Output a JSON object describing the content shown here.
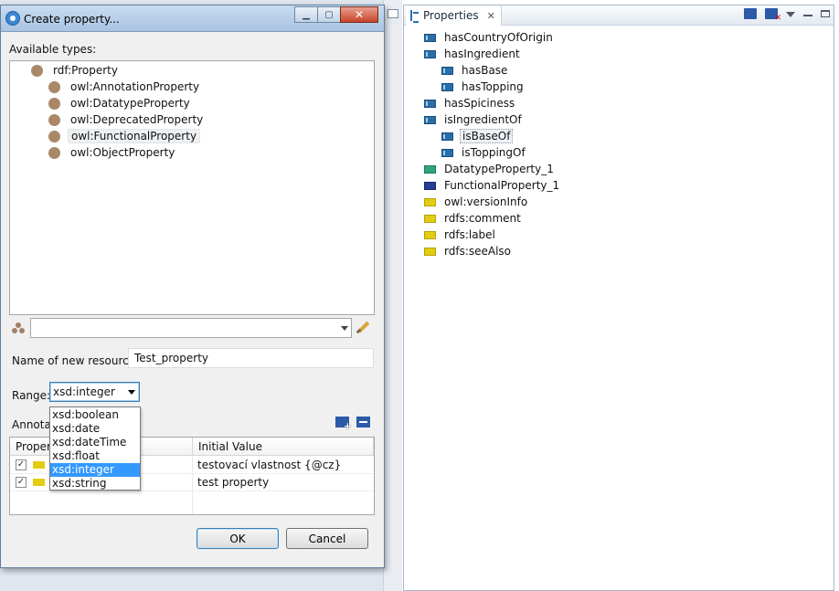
{
  "properties_view": {
    "tab_label": "Properties",
    "items": [
      {
        "label": "hasCountryOfOrigin",
        "kind": "object",
        "indent": 0
      },
      {
        "label": "hasIngredient",
        "kind": "object",
        "indent": 0
      },
      {
        "label": "hasBase",
        "kind": "object",
        "indent": 1
      },
      {
        "label": "hasTopping",
        "kind": "object",
        "indent": 1
      },
      {
        "label": "hasSpiciness",
        "kind": "object",
        "indent": 0
      },
      {
        "label": "isIngredientOf",
        "kind": "object",
        "indent": 0
      },
      {
        "label": "isBaseOf",
        "kind": "object",
        "indent": 1,
        "selected": true
      },
      {
        "label": "isToppingOf",
        "kind": "object",
        "indent": 1
      },
      {
        "label": "DatatypeProperty_1",
        "kind": "datatype",
        "indent": 0
      },
      {
        "label": "FunctionalProperty_1",
        "kind": "functional",
        "indent": 0
      },
      {
        "label": "owl:versionInfo",
        "kind": "annotation",
        "indent": 0
      },
      {
        "label": "rdfs:comment",
        "kind": "annotation",
        "indent": 0
      },
      {
        "label": "rdfs:label",
        "kind": "annotation",
        "indent": 0
      },
      {
        "label": "rdfs:seeAlso",
        "kind": "annotation",
        "indent": 0
      }
    ]
  },
  "dialog": {
    "title": "Create property...",
    "available_types_label": "Available types:",
    "types": [
      {
        "label": "rdf:Property",
        "indent": 0
      },
      {
        "label": "owl:AnnotationProperty",
        "indent": 1
      },
      {
        "label": "owl:DatatypeProperty",
        "indent": 1
      },
      {
        "label": "owl:DeprecatedProperty",
        "indent": 1
      },
      {
        "label": "owl:FunctionalProperty",
        "indent": 1,
        "selected": true
      },
      {
        "label": "owl:ObjectProperty",
        "indent": 1
      }
    ],
    "filter_value": "",
    "name_label": "Name of new resource:",
    "name_value": "Test_property",
    "range_label": "Range:",
    "range_value": "xsd:integer",
    "range_options": [
      "xsd:boolean",
      "xsd:date",
      "xsd:dateTime",
      "xsd:float",
      "xsd:integer",
      "xsd:string"
    ],
    "range_selected_index": 4,
    "annotations_label": "Annotations:",
    "annotations_table": {
      "columns": [
        "Property",
        "Initial Value"
      ],
      "rows": [
        {
          "checked": true,
          "value": "testovací vlastnost {@cz}"
        },
        {
          "checked": true,
          "value": "test property"
        }
      ]
    },
    "ok_label": "OK",
    "cancel_label": "Cancel"
  },
  "colors": {
    "object_property": "#2a6ea8",
    "datatype_property": "#31a47a",
    "functional_property": "#243f9a",
    "annotation_property": "#e2cd12",
    "type_node": "#a98868",
    "dropdown_selection": "#3399ff"
  }
}
